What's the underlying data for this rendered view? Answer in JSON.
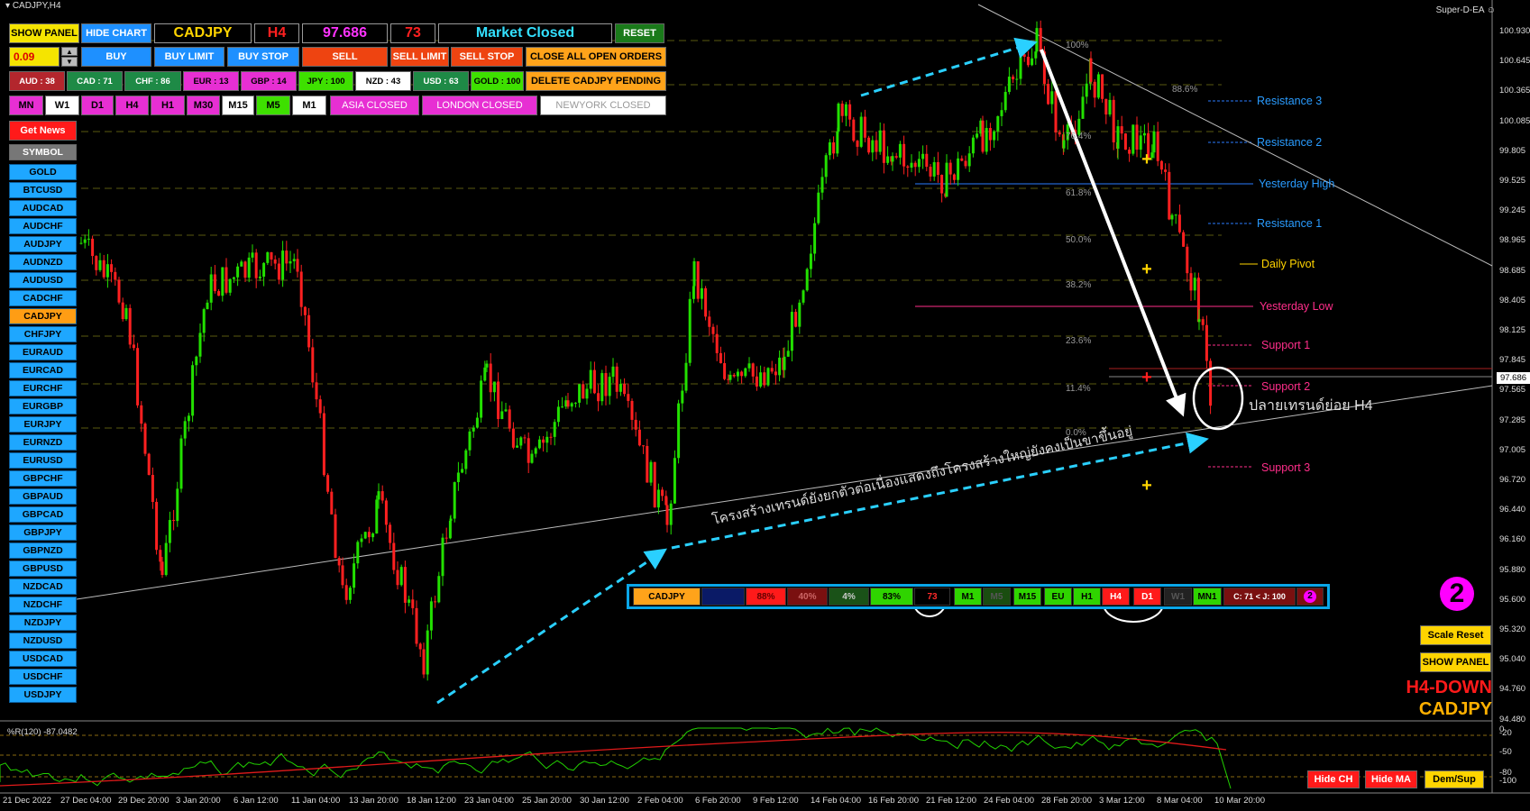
{
  "window": {
    "title": "CADJPY,H4",
    "ea_name": "Super-D-EA"
  },
  "panel": {
    "show_panel": "SHOW PANEL",
    "hide_chart": "HIDE CHART",
    "symbol": "CADJPY",
    "timeframe": "H4",
    "price": "97.686",
    "count": "73",
    "market_status": "Market Closed",
    "reset": "RESET",
    "lot": "0.09",
    "buy": "BUY",
    "buy_limit": "BUY LIMIT",
    "buy_stop": "BUY STOP",
    "sell": "SELL",
    "sell_limit": "SELL LIMIT",
    "sell_stop": "SELL STOP",
    "close_all": "CLOSE ALL OPEN ORDERS",
    "delete_pending": "DELETE CADJPY PENDING",
    "currencies": [
      {
        "label": "AUD : 38",
        "bg": "#b3262d",
        "fg": "#ffffff"
      },
      {
        "label": "CAD : 71",
        "bg": "#1e8a46",
        "fg": "#ffffff"
      },
      {
        "label": "CHF : 86",
        "bg": "#1e8a46",
        "fg": "#ffffff"
      },
      {
        "label": "EUR : 13",
        "bg": "#e72fd3",
        "fg": "#000000"
      },
      {
        "label": "GBP : 14",
        "bg": "#e72fd3",
        "fg": "#000000"
      },
      {
        "label": "JPY : 100",
        "bg": "#3ee000",
        "fg": "#000000"
      },
      {
        "label": "NZD : 43",
        "bg": "#ffffff",
        "fg": "#000000"
      },
      {
        "label": "USD : 63",
        "bg": "#1e8a46",
        "fg": "#ffffff"
      },
      {
        "label": "GOLD : 100",
        "bg": "#3ee000",
        "fg": "#000000"
      }
    ],
    "timeframes": [
      {
        "label": "MN",
        "bg": "#e72fd3"
      },
      {
        "label": "W1",
        "bg": "#ffffff"
      },
      {
        "label": "D1",
        "bg": "#e72fd3"
      },
      {
        "label": "H4",
        "bg": "#e72fd3"
      },
      {
        "label": "H1",
        "bg": "#e72fd3"
      },
      {
        "label": "M30",
        "bg": "#e72fd3"
      },
      {
        "label": "M15",
        "bg": "#ffffff"
      },
      {
        "label": "M5",
        "bg": "#3ee000"
      },
      {
        "label": "M1",
        "bg": "#ffffff"
      }
    ],
    "sessions": [
      "ASIA CLOSED",
      "LONDON CLOSED",
      "NEWYORK CLOSED"
    ],
    "get_news": "Get News",
    "symbol_header": "SYMBOL",
    "symbols": [
      "GOLD",
      "BTCUSD",
      "AUDCAD",
      "AUDCHF",
      "AUDJPY",
      "AUDNZD",
      "AUDUSD",
      "CADCHF",
      "CADJPY",
      "CHFJPY",
      "EURAUD",
      "EURCAD",
      "EURCHF",
      "EURGBP",
      "EURJPY",
      "EURNZD",
      "EURUSD",
      "GBPCHF",
      "GBPAUD",
      "GBPCAD",
      "GBPJPY",
      "GBPNZD",
      "GBPUSD",
      "NZDCAD",
      "NZDCHF",
      "NZDJPY",
      "NZDUSD",
      "USDCAD",
      "USDCHF",
      "USDJPY"
    ],
    "active_symbol": "CADJPY"
  },
  "levels": {
    "resistance3": "Resistance 3",
    "resistance2": "Resistance 2",
    "yesterday_high": "Yesterday High",
    "resistance1": "Resistance 1",
    "daily_pivot": "Daily Pivot",
    "yesterday_low": "Yesterday Low",
    "support1": "Support 1",
    "support2": "Support 2",
    "support3": "Support 3"
  },
  "fib": [
    "100%",
    "88.6%",
    "76.4%",
    "61.8%",
    "50.0%",
    "38.2%",
    "23.6%",
    "11.4%",
    "0.0%"
  ],
  "annotations": {
    "subtrend": "ปลายเทรนด์ย่อย H4",
    "structure": "โครงสร้างเทรนด์ยังยกตัวต่อเนื่องแสดงถึงโครงสร้างใหญ่ยังคงเป็นขาขึ้นอยู่"
  },
  "price_axis": [
    "100.930",
    "100.645",
    "100.365",
    "100.085",
    "99.805",
    "99.525",
    "99.245",
    "98.965",
    "98.685",
    "98.405",
    "98.125",
    "97.845",
    "97.565",
    "97.285",
    "97.005",
    "96.720",
    "96.440",
    "96.160",
    "95.880",
    "95.600",
    "95.320",
    "95.040",
    "94.760",
    "94.480"
  ],
  "current_price_tag": "97.686",
  "time_axis": [
    "21 Dec 2022",
    "27 Dec 04:00",
    "29 Dec 20:00",
    "3 Jan 20:00",
    "6 Jan 12:00",
    "11 Jan 04:00",
    "13 Jan 20:00",
    "18 Jan 12:00",
    "23 Jan 04:00",
    "25 Jan 20:00",
    "30 Jan 12:00",
    "2 Feb 04:00",
    "6 Feb 20:00",
    "9 Feb 12:00",
    "14 Feb 04:00",
    "16 Feb 20:00",
    "21 Feb 12:00",
    "24 Feb 04:00",
    "28 Feb 20:00",
    "3 Mar 12:00",
    "8 Mar 04:00",
    "10 Mar 20:00"
  ],
  "dashboard": {
    "symbol": "CADJPY",
    "pct1": "88%",
    "pct2": "40%",
    "pct3": "4%",
    "pct4": "83%",
    "count": "73",
    "tfs": [
      {
        "label": "M1",
        "bg": "#2fd400",
        "fg": "#000"
      },
      {
        "label": "M5",
        "bg": "#1a4d10",
        "fg": "#555"
      },
      {
        "label": "M15",
        "bg": "#2fd400",
        "fg": "#000"
      },
      {
        "label": "EU",
        "bg": "#2fd400",
        "fg": "#000"
      },
      {
        "label": "H1",
        "bg": "#2fd400",
        "fg": "#000"
      },
      {
        "label": "H4",
        "bg": "#ff1a1a",
        "fg": "#fff"
      },
      {
        "label": "D1",
        "bg": "#ff1a1a",
        "fg": "#fff"
      },
      {
        "label": "W1",
        "bg": "#222",
        "fg": "#555"
      },
      {
        "label": "MN1",
        "bg": "#2fd400",
        "fg": "#000"
      }
    ],
    "cj": "C: 71 < J: 100",
    "badge": "2"
  },
  "right_panel": {
    "big_number": "2",
    "scale_reset": "Scale Reset",
    "show_panel": "SHOW PANEL",
    "trend": "H4-DOWN",
    "symbol": "CADJPY"
  },
  "indicator": {
    "label": "%R(120) -87.0482",
    "levels": [
      "-20",
      "-50",
      "-80"
    ],
    "axis": [
      "0",
      "-20",
      "-50",
      "-80",
      "-100"
    ],
    "hide_ch": "Hide CH",
    "hide_ma": "Hide MA",
    "dem_sup": "Dem/Sup"
  }
}
